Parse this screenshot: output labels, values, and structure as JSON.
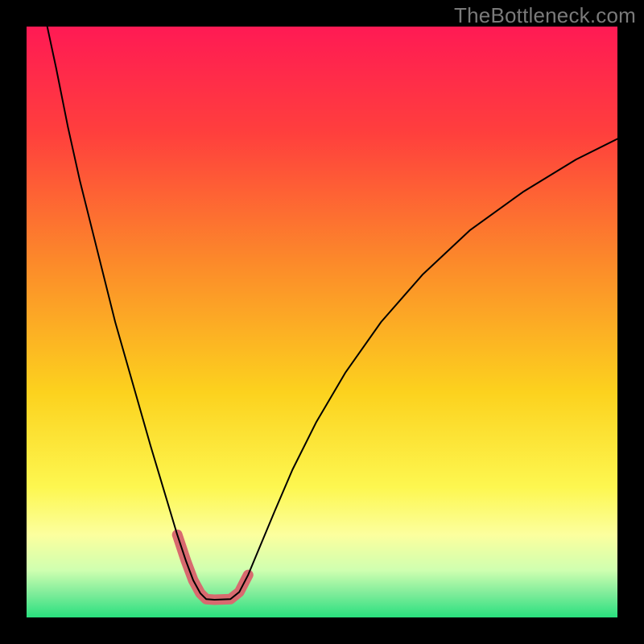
{
  "watermark": "TheBottleneck.com",
  "chart_data": {
    "type": "line",
    "title": "",
    "xlabel": "",
    "ylabel": "",
    "xlim": [
      0,
      100
    ],
    "ylim": [
      0,
      100
    ],
    "background_gradient": {
      "stops": [
        {
          "offset": 0.0,
          "color": "#ff1a54"
        },
        {
          "offset": 0.18,
          "color": "#ff3f3d"
        },
        {
          "offset": 0.4,
          "color": "#fc8a2a"
        },
        {
          "offset": 0.62,
          "color": "#fcd21e"
        },
        {
          "offset": 0.78,
          "color": "#fdf750"
        },
        {
          "offset": 0.86,
          "color": "#fcff9e"
        },
        {
          "offset": 0.92,
          "color": "#cfffb0"
        },
        {
          "offset": 0.96,
          "color": "#7eec9a"
        },
        {
          "offset": 1.0,
          "color": "#29e07e"
        }
      ]
    },
    "series": [
      {
        "name": "bottleneck-curve",
        "stroke": "#000000",
        "stroke_width": 2,
        "x": [
          3.5,
          5,
          7,
          9,
          11,
          13,
          15,
          17,
          19,
          21,
          22.5,
          24,
          25.5,
          27,
          28.2,
          29.4,
          30.4,
          31.8,
          34.5,
          36,
          37.5,
          39.5,
          42,
          45,
          49,
          54,
          60,
          67,
          75,
          84,
          93,
          100
        ],
        "y": [
          100,
          93,
          83,
          74,
          66,
          58,
          50,
          43,
          36,
          29,
          24,
          19,
          14,
          9.5,
          6.3,
          4.1,
          3.1,
          3.0,
          3.1,
          4.3,
          7.2,
          12,
          18,
          25,
          33,
          41.5,
          50,
          58,
          65.5,
          72,
          77.5,
          81
        ]
      },
      {
        "name": "valley-highlight",
        "stroke": "#d86a6f",
        "stroke_width": 13,
        "linecap": "round",
        "x": [
          25.5,
          27,
          28.2,
          29.4,
          30.4,
          31.8,
          34.5,
          36,
          37.5
        ],
        "y": [
          14,
          9.5,
          6.3,
          4.1,
          3.1,
          3.0,
          3.1,
          4.3,
          7.2
        ]
      }
    ]
  }
}
